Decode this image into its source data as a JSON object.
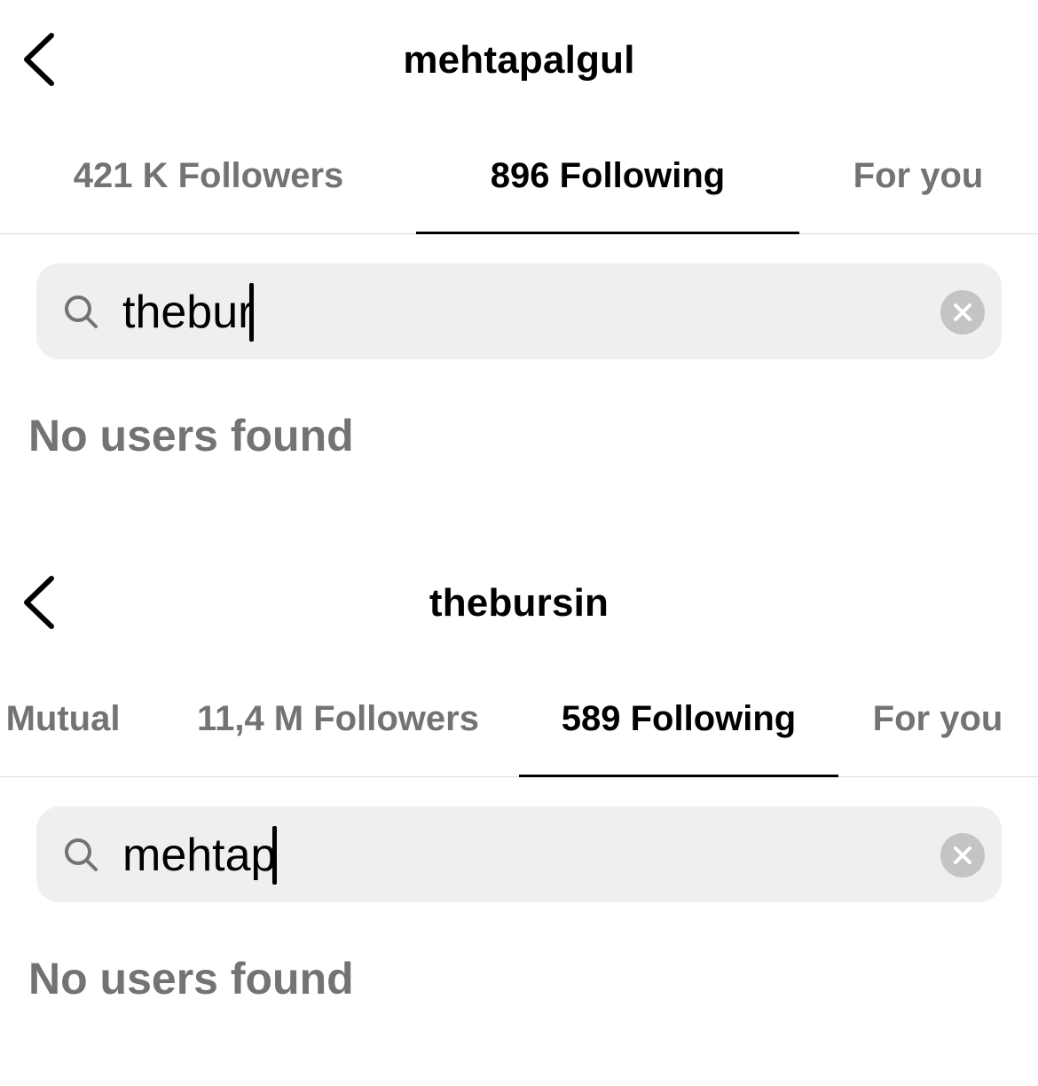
{
  "panels": [
    {
      "title": "mehtapalgul",
      "tabs": [
        {
          "label": "421 K Followers",
          "active": false
        },
        {
          "label": "896 Following",
          "active": true
        },
        {
          "label": "For you",
          "active": false
        }
      ],
      "search": {
        "value": "thebur"
      },
      "empty_message": "No users found"
    },
    {
      "title": "thebursin",
      "tabs": [
        {
          "label": "Mutual",
          "active": false
        },
        {
          "label": "11,4 M Followers",
          "active": false
        },
        {
          "label": "589 Following",
          "active": true
        },
        {
          "label": "For you",
          "active": false
        }
      ],
      "search": {
        "value": "mehtap"
      },
      "empty_message": "No users found"
    }
  ],
  "icons": {
    "back": "chevron-left-icon",
    "search": "search-icon",
    "clear": "clear-icon"
  },
  "colors": {
    "text_primary": "#000000",
    "text_secondary": "#737373",
    "search_bg": "#efefef",
    "divider": "#dbdbdb",
    "clear_bg": "#c4c4c4"
  }
}
